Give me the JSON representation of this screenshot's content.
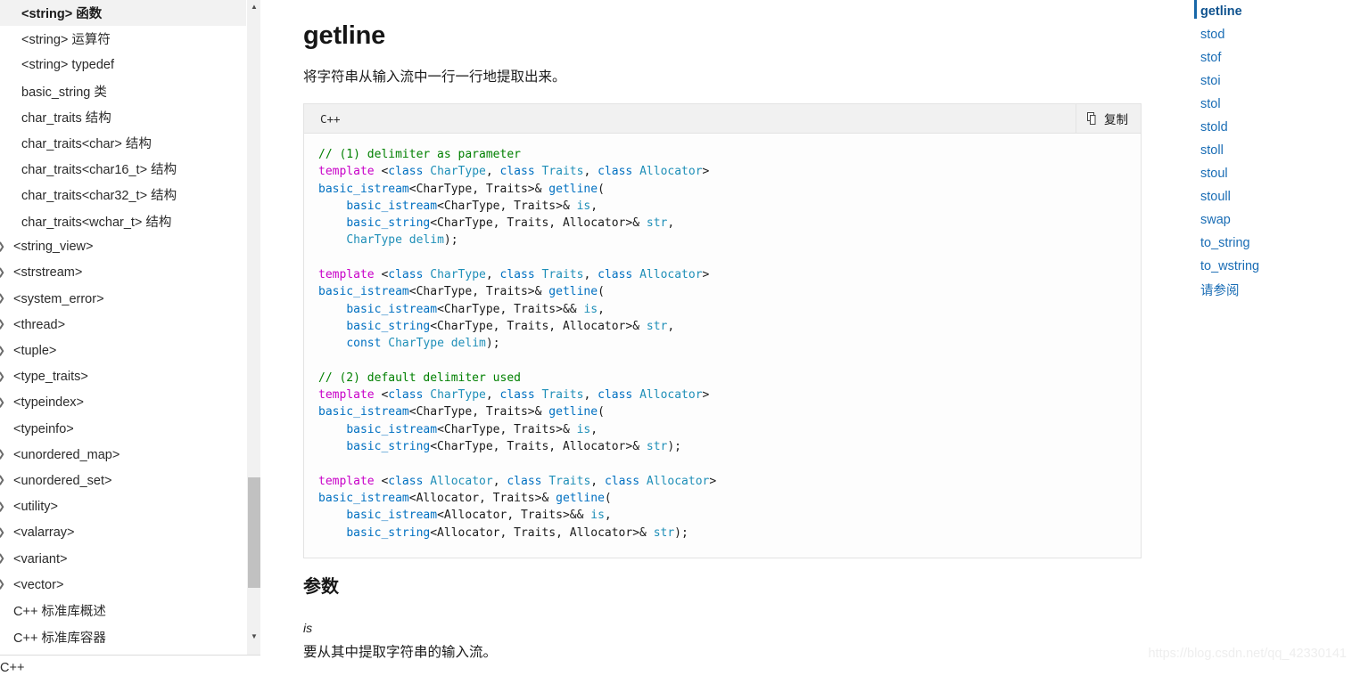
{
  "left_sidebar": {
    "items": [
      {
        "label": "<string> 函数",
        "active": true,
        "indent": true,
        "arrow": false
      },
      {
        "label": "<string> 运算符",
        "active": false,
        "indent": true,
        "arrow": false
      },
      {
        "label": "<string> typedef",
        "active": false,
        "indent": true,
        "arrow": false
      },
      {
        "label": "basic_string 类",
        "active": false,
        "indent": true,
        "arrow": false
      },
      {
        "label": "char_traits 结构",
        "active": false,
        "indent": true,
        "arrow": false
      },
      {
        "label": "char_traits<char> 结构",
        "active": false,
        "indent": true,
        "arrow": false
      },
      {
        "label": "char_traits<char16_t> 结构",
        "active": false,
        "indent": true,
        "arrow": false
      },
      {
        "label": "char_traits<char32_t> 结构",
        "active": false,
        "indent": true,
        "arrow": false
      },
      {
        "label": "char_traits<wchar_t> 结构",
        "active": false,
        "indent": true,
        "arrow": false
      },
      {
        "label": "<string_view>",
        "active": false,
        "indent": false,
        "arrow": true
      },
      {
        "label": "<strstream>",
        "active": false,
        "indent": false,
        "arrow": true
      },
      {
        "label": "<system_error>",
        "active": false,
        "indent": false,
        "arrow": true
      },
      {
        "label": "<thread>",
        "active": false,
        "indent": false,
        "arrow": true
      },
      {
        "label": "<tuple>",
        "active": false,
        "indent": false,
        "arrow": true
      },
      {
        "label": "<type_traits>",
        "active": false,
        "indent": false,
        "arrow": true
      },
      {
        "label": "<typeindex>",
        "active": false,
        "indent": false,
        "arrow": true
      },
      {
        "label": "<typeinfo>",
        "active": false,
        "indent": false,
        "arrow": false
      },
      {
        "label": "<unordered_map>",
        "active": false,
        "indent": false,
        "arrow": true
      },
      {
        "label": "<unordered_set>",
        "active": false,
        "indent": false,
        "arrow": true
      },
      {
        "label": "<utility>",
        "active": false,
        "indent": false,
        "arrow": true
      },
      {
        "label": "<valarray>",
        "active": false,
        "indent": false,
        "arrow": true
      },
      {
        "label": "<variant>",
        "active": false,
        "indent": false,
        "arrow": true
      },
      {
        "label": "<vector>",
        "active": false,
        "indent": false,
        "arrow": true
      },
      {
        "label": "C++ 标准库概述",
        "active": false,
        "indent": false,
        "arrow": false
      },
      {
        "label": "C++ 标准库容器",
        "active": false,
        "indent": false,
        "arrow": false
      }
    ],
    "scroll_up_icon": "caret-up-icon",
    "scroll_down_icon": "caret-down-icon",
    "bottom_partial_text": "C++"
  },
  "main": {
    "title": "getline",
    "description": "将字符串从输入流中一行一行地提取出来。",
    "code": {
      "language": "C++",
      "copy_label": "复制",
      "copy_icon": "copy-icon",
      "lines": [
        [
          {
            "t": "// (1) delimiter as parameter",
            "c": "t-cm"
          }
        ],
        [
          {
            "t": "template ",
            "c": "t-kw"
          },
          {
            "t": "<",
            "c": "t-id"
          },
          {
            "t": "class ",
            "c": "t-cl"
          },
          {
            "t": "CharType",
            "c": "t-ty"
          },
          {
            "t": ", ",
            "c": "t-id"
          },
          {
            "t": "class ",
            "c": "t-cl"
          },
          {
            "t": "Traits",
            "c": "t-ty"
          },
          {
            "t": ", ",
            "c": "t-id"
          },
          {
            "t": "class ",
            "c": "t-cl"
          },
          {
            "t": "Allocator",
            "c": "t-ty"
          },
          {
            "t": ">",
            "c": "t-id"
          }
        ],
        [
          {
            "t": "basic_istream",
            "c": "t-fn"
          },
          {
            "t": "<CharType, Traits>& ",
            "c": "t-id"
          },
          {
            "t": "getline",
            "c": "t-fn"
          },
          {
            "t": "(",
            "c": "t-id"
          }
        ],
        [
          {
            "t": "    ",
            "c": "t-id"
          },
          {
            "t": "basic_istream",
            "c": "t-fn"
          },
          {
            "t": "<CharType, Traits>& ",
            "c": "t-id"
          },
          {
            "t": "is",
            "c": "t-ty"
          },
          {
            "t": ",",
            "c": "t-id"
          }
        ],
        [
          {
            "t": "    ",
            "c": "t-id"
          },
          {
            "t": "basic_string",
            "c": "t-fn"
          },
          {
            "t": "<CharType, Traits, Allocator>& ",
            "c": "t-id"
          },
          {
            "t": "str",
            "c": "t-ty"
          },
          {
            "t": ",",
            "c": "t-id"
          }
        ],
        [
          {
            "t": "    ",
            "c": "t-id"
          },
          {
            "t": "CharType ",
            "c": "t-ty"
          },
          {
            "t": "delim",
            "c": "t-ty"
          },
          {
            "t": ");",
            "c": "t-id"
          }
        ],
        [
          {
            "t": "",
            "c": "t-id"
          }
        ],
        [
          {
            "t": "template ",
            "c": "t-kw"
          },
          {
            "t": "<",
            "c": "t-id"
          },
          {
            "t": "class ",
            "c": "t-cl"
          },
          {
            "t": "CharType",
            "c": "t-ty"
          },
          {
            "t": ", ",
            "c": "t-id"
          },
          {
            "t": "class ",
            "c": "t-cl"
          },
          {
            "t": "Traits",
            "c": "t-ty"
          },
          {
            "t": ", ",
            "c": "t-id"
          },
          {
            "t": "class ",
            "c": "t-cl"
          },
          {
            "t": "Allocator",
            "c": "t-ty"
          },
          {
            "t": ">",
            "c": "t-id"
          }
        ],
        [
          {
            "t": "basic_istream",
            "c": "t-fn"
          },
          {
            "t": "<CharType, Traits>& ",
            "c": "t-id"
          },
          {
            "t": "getline",
            "c": "t-fn"
          },
          {
            "t": "(",
            "c": "t-id"
          }
        ],
        [
          {
            "t": "    ",
            "c": "t-id"
          },
          {
            "t": "basic_istream",
            "c": "t-fn"
          },
          {
            "t": "<CharType, Traits>&& ",
            "c": "t-id"
          },
          {
            "t": "is",
            "c": "t-ty"
          },
          {
            "t": ",",
            "c": "t-id"
          }
        ],
        [
          {
            "t": "    ",
            "c": "t-id"
          },
          {
            "t": "basic_string",
            "c": "t-fn"
          },
          {
            "t": "<CharType, Traits, Allocator>& ",
            "c": "t-id"
          },
          {
            "t": "str",
            "c": "t-ty"
          },
          {
            "t": ",",
            "c": "t-id"
          }
        ],
        [
          {
            "t": "    ",
            "c": "t-id"
          },
          {
            "t": "const ",
            "c": "t-cl"
          },
          {
            "t": "CharType ",
            "c": "t-ty"
          },
          {
            "t": "delim",
            "c": "t-ty"
          },
          {
            "t": ");",
            "c": "t-id"
          }
        ],
        [
          {
            "t": "",
            "c": "t-id"
          }
        ],
        [
          {
            "t": "// (2) default delimiter used",
            "c": "t-cm"
          }
        ],
        [
          {
            "t": "template ",
            "c": "t-kw"
          },
          {
            "t": "<",
            "c": "t-id"
          },
          {
            "t": "class ",
            "c": "t-cl"
          },
          {
            "t": "CharType",
            "c": "t-ty"
          },
          {
            "t": ", ",
            "c": "t-id"
          },
          {
            "t": "class ",
            "c": "t-cl"
          },
          {
            "t": "Traits",
            "c": "t-ty"
          },
          {
            "t": ", ",
            "c": "t-id"
          },
          {
            "t": "class ",
            "c": "t-cl"
          },
          {
            "t": "Allocator",
            "c": "t-ty"
          },
          {
            "t": ">",
            "c": "t-id"
          }
        ],
        [
          {
            "t": "basic_istream",
            "c": "t-fn"
          },
          {
            "t": "<CharType, Traits>& ",
            "c": "t-id"
          },
          {
            "t": "getline",
            "c": "t-fn"
          },
          {
            "t": "(",
            "c": "t-id"
          }
        ],
        [
          {
            "t": "    ",
            "c": "t-id"
          },
          {
            "t": "basic_istream",
            "c": "t-fn"
          },
          {
            "t": "<CharType, Traits>& ",
            "c": "t-id"
          },
          {
            "t": "is",
            "c": "t-ty"
          },
          {
            "t": ",",
            "c": "t-id"
          }
        ],
        [
          {
            "t": "    ",
            "c": "t-id"
          },
          {
            "t": "basic_string",
            "c": "t-fn"
          },
          {
            "t": "<CharType, Traits, Allocator>& ",
            "c": "t-id"
          },
          {
            "t": "str",
            "c": "t-ty"
          },
          {
            "t": ");",
            "c": "t-id"
          }
        ],
        [
          {
            "t": "",
            "c": "t-id"
          }
        ],
        [
          {
            "t": "template ",
            "c": "t-kw"
          },
          {
            "t": "<",
            "c": "t-id"
          },
          {
            "t": "class ",
            "c": "t-cl"
          },
          {
            "t": "Allocator",
            "c": "t-ty"
          },
          {
            "t": ", ",
            "c": "t-id"
          },
          {
            "t": "class ",
            "c": "t-cl"
          },
          {
            "t": "Traits",
            "c": "t-ty"
          },
          {
            "t": ", ",
            "c": "t-id"
          },
          {
            "t": "class ",
            "c": "t-cl"
          },
          {
            "t": "Allocator",
            "c": "t-ty"
          },
          {
            "t": ">",
            "c": "t-id"
          }
        ],
        [
          {
            "t": "basic_istream",
            "c": "t-fn"
          },
          {
            "t": "<Allocator, Traits>& ",
            "c": "t-id"
          },
          {
            "t": "getline",
            "c": "t-fn"
          },
          {
            "t": "(",
            "c": "t-id"
          }
        ],
        [
          {
            "t": "    ",
            "c": "t-id"
          },
          {
            "t": "basic_istream",
            "c": "t-fn"
          },
          {
            "t": "<Allocator, Traits>&& ",
            "c": "t-id"
          },
          {
            "t": "is",
            "c": "t-ty"
          },
          {
            "t": ",",
            "c": "t-id"
          }
        ],
        [
          {
            "t": "    ",
            "c": "t-id"
          },
          {
            "t": "basic_string",
            "c": "t-fn"
          },
          {
            "t": "<Allocator, Traits, Allocator>& ",
            "c": "t-id"
          },
          {
            "t": "str",
            "c": "t-ty"
          },
          {
            "t": ");",
            "c": "t-id"
          }
        ]
      ]
    },
    "params": {
      "heading": "参数",
      "name": "is",
      "description": "要从其中提取字符串的输入流。"
    }
  },
  "right_toc": {
    "items": [
      {
        "label": "getline",
        "active": true
      },
      {
        "label": "stod",
        "active": false
      },
      {
        "label": "stof",
        "active": false
      },
      {
        "label": "stoi",
        "active": false
      },
      {
        "label": "stol",
        "active": false
      },
      {
        "label": "stold",
        "active": false
      },
      {
        "label": "stoll",
        "active": false
      },
      {
        "label": "stoul",
        "active": false
      },
      {
        "label": "stoull",
        "active": false
      },
      {
        "label": "swap",
        "active": false
      },
      {
        "label": "to_string",
        "active": false
      },
      {
        "label": "to_wstring",
        "active": false
      },
      {
        "label": "请参阅",
        "active": false
      }
    ]
  },
  "watermark": "https://blog.csdn.net/qq_42330141",
  "colors": {
    "accent_blue": "#1a6db5",
    "active_indicator": "#1767a8",
    "sidebar_active_bg": "#f2f2f2",
    "code_header_bg": "#f1f1f1",
    "code_border": "#e3e3e3",
    "comment_green": "#008000",
    "keyword_magenta": "#c800c8",
    "class_blue": "#0070c1",
    "type_teal": "#1f8fb8"
  }
}
